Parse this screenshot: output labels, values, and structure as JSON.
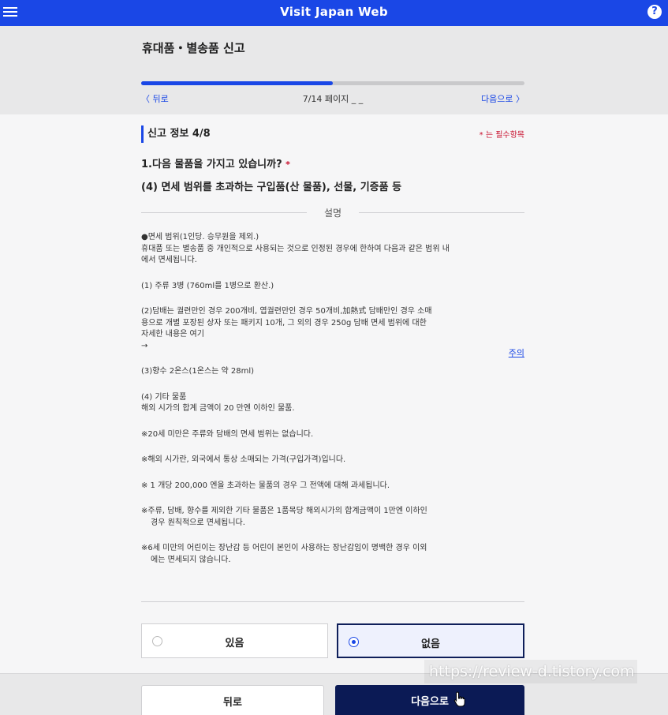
{
  "app": {
    "title": "Visit Japan Web",
    "help_icon": "?"
  },
  "header": {
    "page_title": "휴대품・별송품 신고",
    "progress_fraction": 0.5,
    "back_label": "〈 뒤로",
    "page_indicator": "7/14 페이지 _ _",
    "next_label": "다음으로 〉"
  },
  "form": {
    "section_title": "신고 정보 4/8",
    "required_note": "* 는 필수항목",
    "question1": "1.다음 물품을 가지고 있습니까?",
    "question1_required": "*",
    "question2": "(4) 면세 범위를 초과하는 구입품(산 물품), 선물, 기증품 등",
    "description_label": "설명",
    "description": {
      "p1_l1": "●면세 범위(1인당. 승무원을 제외.)",
      "p1_l2": "휴대품 또는 별송품 중 개인적으로 사용되는 것으로 인정된 경우에 한하여 다음과 같은 범위 내",
      "p1_l3": "에서 면세됩니다.",
      "p2": "(1) 주류 3병 (760ml를 1병으로 환산.)",
      "p3_l1": "(2)담배는 궐련만인 경우 200개비, 엽궐련만인 경우 50개비,加熱式 담배만인 경우 소매",
      "p3_l2": "용으로 개별 포장된 상자 또는 패키지 10개, 그 외의 경우 250g 담배 면세 범위에 대한",
      "p3_l3": "자세한 내용은 여기",
      "p3_l4": "→",
      "p4": "(3)향수 2온스(1온스는 약 28ml)",
      "p5_l1": "(4) 기타 물품",
      "p5_l2": "해외 시가의 합계 금액이 20 만엔 이하인 물품.",
      "p6": "※20세 미만은 주류와 담배의 면세 범위는 없습니다.",
      "p7": "※해외 시가란, 외국에서 통상 소매되는 가격(구입가격)입니다.",
      "p8": "※ 1 개당 200,000 엔을 초과하는 물품의 경우 그 전액에 대해 과세됩니다.",
      "p9_l1": "※주류, 담배, 향수를 제외한 기타 물품은 1품목당 해외시가의 합계금액이 1만엔 이하인",
      "p9_l2": "경우 원칙적으로 면세됩니다.",
      "p10_l1": "※6세 미만의 어린이는 장난감 등 어린이 본인이 사용하는 장난감임이 명백한 경우 이외",
      "p10_l2": "에는 면세되지 않습니다."
    },
    "note_link": "주의",
    "option_yes": "있음",
    "option_no": "없음",
    "selected": "없음"
  },
  "footer": {
    "back_button": "뒤로",
    "next_button": "다음으로"
  },
  "watermark": "https://review-d.tistory.com",
  "colors": {
    "brand_blue": "#1a47e6",
    "dark_navy": "#0b1a55",
    "required_red": "#c8102e"
  }
}
